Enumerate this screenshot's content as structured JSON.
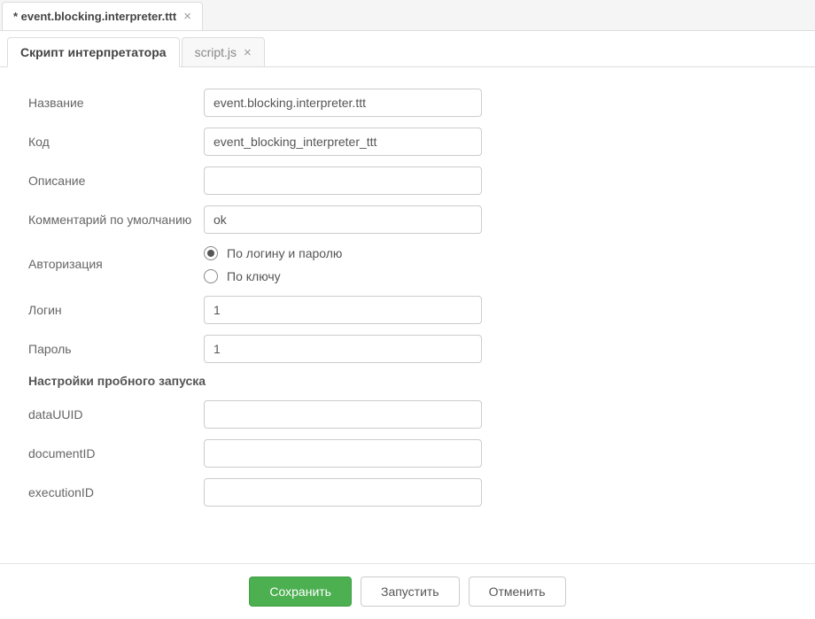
{
  "outer_tab": {
    "title": "* event.blocking.interpreter.ttt"
  },
  "inner_tabs": [
    {
      "label": "Скрипт интерпретатора",
      "active": true
    },
    {
      "label": "script.js",
      "active": false
    }
  ],
  "form": {
    "name_label": "Название",
    "name_value": "event.blocking.interpreter.ttt",
    "code_label": "Код",
    "code_value": "event_blocking_interpreter_ttt",
    "description_label": "Описание",
    "description_value": "",
    "default_comment_label": "Комментарий по умолчанию",
    "default_comment_value": "ok",
    "auth_label": "Авторизация",
    "auth_options": {
      "by_login": "По логину и паролю",
      "by_key": "По ключу"
    },
    "login_label": "Логин",
    "login_value": "1",
    "password_label": "Пароль",
    "password_value": "1",
    "trial_section": "Настройки пробного запуска",
    "data_uuid_label": "dataUUID",
    "data_uuid_value": "",
    "document_id_label": "documentID",
    "document_id_value": "",
    "execution_id_label": "executionID",
    "execution_id_value": ""
  },
  "buttons": {
    "save": "Сохранить",
    "run": "Запустить",
    "cancel": "Отменить"
  }
}
